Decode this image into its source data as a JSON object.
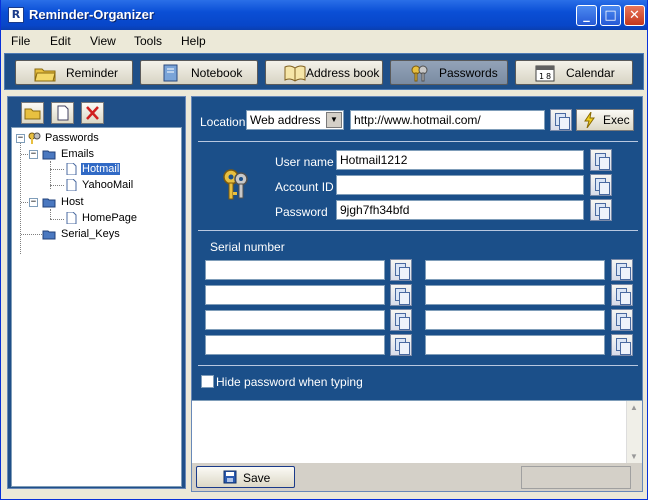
{
  "window": {
    "title": "Reminder-Organizer"
  },
  "menu": [
    "File",
    "Edit",
    "View",
    "Tools",
    "Help"
  ],
  "nav": {
    "buttons": [
      {
        "label": "Reminder",
        "icon": "reminder-folder-icon"
      },
      {
        "label": "Notebook",
        "icon": "notebook-icon"
      },
      {
        "label": "Address book",
        "icon": "address-book-icon"
      },
      {
        "label": "Passwords",
        "icon": "keys-icon",
        "active": true
      },
      {
        "label": "Calendar",
        "icon": "calendar-icon"
      }
    ]
  },
  "tree": {
    "root": "Passwords",
    "groups": [
      {
        "label": "Emails",
        "items": [
          "Hotmail",
          "YahooMail"
        ]
      },
      {
        "label": "Host",
        "items": [
          "HomePage"
        ]
      },
      {
        "label": "Serial_Keys",
        "items": []
      }
    ],
    "selected": "Hotmail"
  },
  "location": {
    "label": "Location",
    "type_value": "Web address",
    "url": "http://www.hotmail.com/",
    "exec_label": "Exec"
  },
  "credentials": {
    "username_label": "User name",
    "username": "Hotmail1212",
    "account_label": "Account ID",
    "account": "",
    "password_label": "Password",
    "password": "9jgh7fh34bfd"
  },
  "serial": {
    "label": "Serial number",
    "fields": [
      "",
      "",
      "",
      "",
      "",
      "",
      "",
      ""
    ]
  },
  "hide_password_label": "Hide password when typing",
  "save_label": "Save",
  "colors": {
    "panel": "#1b4f89",
    "toolbar": "#1f4f88",
    "titlebar": "#0a4fd6",
    "selection": "#316ac5"
  }
}
